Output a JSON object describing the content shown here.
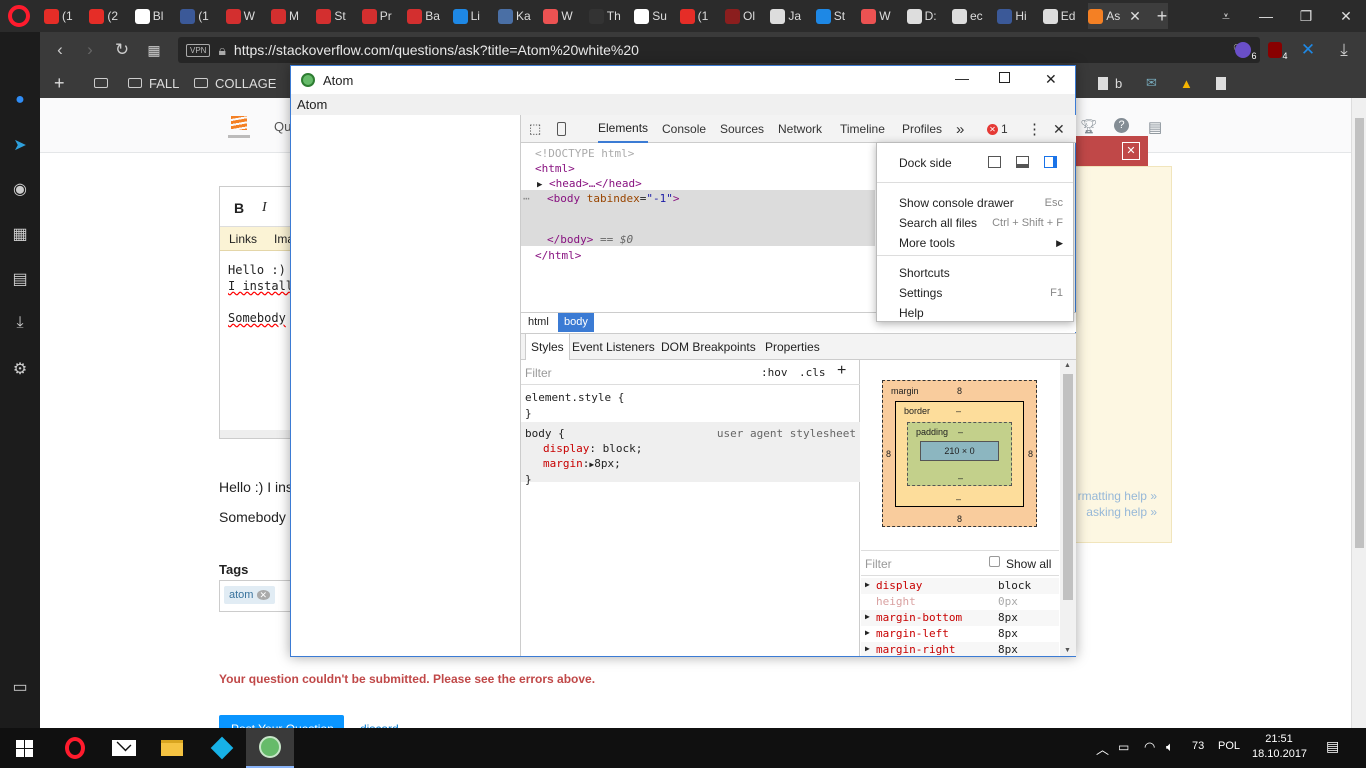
{
  "browser": {
    "tabs": [
      {
        "label": "(1",
        "icon": "youtube-icon",
        "color": "#e52d27"
      },
      {
        "label": "(2",
        "icon": "youtube-icon",
        "color": "#e52d27"
      },
      {
        "label": "Bl",
        "icon": "gmail-icon",
        "color": "#ffffff"
      },
      {
        "label": "(1",
        "icon": "facebook-icon",
        "color": "#3b5998"
      },
      {
        "label": "W",
        "icon": "app-red-icon",
        "color": "#d32f2f"
      },
      {
        "label": "M",
        "icon": "app-red-icon",
        "color": "#d32f2f"
      },
      {
        "label": "St",
        "icon": "app-red-icon",
        "color": "#d32f2f"
      },
      {
        "label": "Pr",
        "icon": "app-red-icon",
        "color": "#d32f2f"
      },
      {
        "label": "Ba",
        "icon": "app-red-icon",
        "color": "#d32f2f"
      },
      {
        "label": "Li",
        "icon": "cross-icon",
        "color": "#1e88e5"
      },
      {
        "label": "Ka",
        "icon": "calendar-icon",
        "color": "#4a6fa5"
      },
      {
        "label": "W",
        "icon": "udemy-icon",
        "color": "#ec5252"
      },
      {
        "label": "Th",
        "icon": "github-icon",
        "color": "#333333"
      },
      {
        "label": "Su",
        "icon": "google-icon",
        "color": "#ffffff"
      },
      {
        "label": "(1",
        "icon": "youtube-icon",
        "color": "#e52d27"
      },
      {
        "label": "Ol",
        "icon": "app-red-icon",
        "color": "#8b1e1e"
      },
      {
        "label": "Ja",
        "icon": "page-icon",
        "color": "#dddddd"
      },
      {
        "label": "St",
        "icon": "cross-icon",
        "color": "#1e88e5"
      },
      {
        "label": "W",
        "icon": "udemy-icon",
        "color": "#ec5252"
      },
      {
        "label": "D:",
        "icon": "page-icon",
        "color": "#dddddd"
      },
      {
        "label": "ec",
        "icon": "page-icon",
        "color": "#dddddd"
      },
      {
        "label": "Hi",
        "icon": "facebook-icon",
        "color": "#3b5998"
      },
      {
        "label": "Ed",
        "icon": "page-icon",
        "color": "#dddddd"
      },
      {
        "label": "As",
        "icon": "stackoverflow-icon",
        "color": "#f48024"
      }
    ],
    "url": "https://stackoverflow.com/questions/ask?title=Atom%20white%20",
    "vpn": "VPN",
    "bookmarks": [
      "FALL",
      "COLLAGE"
    ],
    "bookmark_b": "b",
    "ext_badges": [
      "6",
      "4"
    ]
  },
  "page": {
    "nav_label": "Qu",
    "toolbar_bold": "B",
    "toolbar_italic": "I",
    "links_tab": "Links",
    "images_tab": "Ima",
    "editor_lines": [
      "Hello :)",
      "I install",
      "",
      "Somebody"
    ],
    "preview_line1": "Hello :) I ins",
    "preview_line2": "Somebody c",
    "tags_label": "Tags",
    "tag_chip": "atom",
    "help_line1": "rmatting help »",
    "help_line2": "asking help »",
    "error_msg": "Your question couldn't be submitted. Please see the errors above.",
    "post_button": "Post Your Question",
    "discard": "discard"
  },
  "atom": {
    "title": "Atom",
    "menu": "Atom",
    "devtools": {
      "tabs": [
        "Elements",
        "Console",
        "Sources",
        "Network",
        "Timeline",
        "Profiles"
      ],
      "more": "»",
      "error_count": "1",
      "dom": {
        "doctype": "<!DOCTYPE html>",
        "html_open": "<html>",
        "head": "<head>…</head>",
        "body_tag": "body",
        "body_attr": "tabindex",
        "body_val": "\"-1\"",
        "body_close": "</body>",
        "body_suffix": "== $0",
        "html_close": "</html>"
      },
      "breadcrumbs": [
        "html",
        "body"
      ],
      "subtabs": [
        "Styles",
        "Event Listeners",
        "DOM Breakpoints",
        "Properties"
      ],
      "filter_placeholder": "Filter",
      "hov": ":hov",
      "cls": ".cls",
      "rule1": "element.style {",
      "rule_close": "}",
      "rule2_selector": "body {",
      "rule2_source": "user agent stylesheet",
      "rule2_decls": [
        {
          "prop": "display",
          "val": "block;"
        },
        {
          "prop": "margin",
          "val": "8px;"
        }
      ],
      "boxmodel": {
        "margin_label": "margin",
        "border_label": "border",
        "padding_label": "padding",
        "content": "210 × 0",
        "margin": "8",
        "dash": "–"
      },
      "computed_filter": "Filter",
      "show_all": "Show all",
      "computed": [
        {
          "prop": "display",
          "val": "block",
          "dim": false
        },
        {
          "prop": "height",
          "val": "0px",
          "dim": true
        },
        {
          "prop": "margin-bottom",
          "val": "8px",
          "dim": false
        },
        {
          "prop": "margin-left",
          "val": "8px",
          "dim": false
        },
        {
          "prop": "margin-right",
          "val": "8px",
          "dim": false
        }
      ],
      "menu": {
        "dock_side": "Dock side",
        "items": [
          {
            "label": "Show console drawer",
            "shortcut": "Esc"
          },
          {
            "label": "Search all files",
            "shortcut": "Ctrl + Shift + F"
          },
          {
            "label": "More tools",
            "shortcut": "▶"
          },
          {
            "label": "Shortcuts",
            "shortcut": ""
          },
          {
            "label": "Settings",
            "shortcut": "F1"
          },
          {
            "label": "Help",
            "shortcut": ""
          }
        ]
      }
    }
  },
  "taskbar": {
    "battery": "73",
    "lang": "POL",
    "time": "21:51",
    "date": "18.10.2017"
  }
}
